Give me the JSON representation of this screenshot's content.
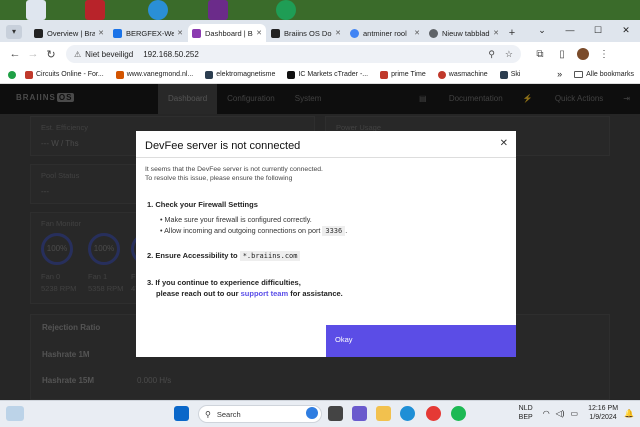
{
  "browser": {
    "tab_list_icon": "▾",
    "tabs": [
      {
        "title": "Overview | Bra",
        "color": "#222222"
      },
      {
        "title": "BERGFEX-Weer",
        "color": "#1a73e8"
      },
      {
        "title": "Dashboard | Bra",
        "color": "#8b3ab0",
        "active": true
      },
      {
        "title": "Braiins OS Do",
        "color": "#222222"
      },
      {
        "title": "antminer rool",
        "color": "#4285f4"
      },
      {
        "title": "Nieuw tabblad",
        "color": "#5f6368"
      }
    ],
    "new_tab": "+",
    "window_controls": [
      "⌄",
      "—",
      "☐",
      "✕"
    ],
    "security_label": "Niet beveiligd",
    "url": "192.168.50.252",
    "bookmarks": [
      {
        "label": "Circuits Online - For...",
        "color": "#c0392b"
      },
      {
        "label": "www.vanegmond.nl...",
        "color": "#d35400"
      },
      {
        "label": "elektromagnetisme",
        "color": "#2c3e50"
      },
      {
        "label": "IC Markets cTrader -...",
        "color": "#111111"
      },
      {
        "label": "prime Time",
        "color": "#c0392b"
      },
      {
        "label": "wasmachine",
        "color": "#c0392b"
      },
      {
        "label": "Ski",
        "color": "#2c3e50"
      }
    ],
    "all_bookmarks": "Alle bookmarks"
  },
  "app": {
    "logo_text": "BRAIINS",
    "logo_os": "OS",
    "nav": [
      "Dashboard",
      "Configuration",
      "System"
    ],
    "nav_right": [
      "Documentation",
      "Quick Actions"
    ],
    "est_efficiency_label": "Est. Efficiency",
    "est_efficiency_value": "--- W / Ths",
    "power_usage_label": "Power Usage",
    "pool_status_label": "Pool Status",
    "pool_status_value": "---",
    "fan_monitor_label": "Fan Monitor",
    "fans": [
      {
        "pct": "100%",
        "name": "Fan 0",
        "rpm": "5238 RPM"
      },
      {
        "pct": "100%",
        "name": "Fan 1",
        "rpm": "5358 RPM"
      },
      {
        "pct": "",
        "name": "Fa",
        "rpm": "47"
      }
    ],
    "rejection_ratio_label": "Rejection Ratio",
    "hashrate_1m_label": "Hashrate 1M",
    "hashrate_15m_label": "Hashrate 15M",
    "hashrate_15m_value": "0.000 H/s"
  },
  "modal": {
    "title": "DevFee server is not connected",
    "intro_line1": "It seems that the DevFee server is not currently connected.",
    "intro_line2": "To resolve this issue, please ensure the following",
    "step1_title": "1. Check your Firewall Settings",
    "step1_bullet1": "Make sure your firewall is configured correctly.",
    "step1_bullet2_pre": "Allow incoming and outgoing connections on port",
    "port": "3336",
    "step2_title": "2. Ensure Accessibility to",
    "domain": "*.braiins.com",
    "step3_line1": "3. If you continue to experience difficulties,",
    "step3_line2_pre": "please reach out to our",
    "support_link": "support team",
    "step3_line2_post": "for assistance.",
    "okay_label": "Okay"
  },
  "taskbar": {
    "search_placeholder": "Search",
    "lang_top": "NLD",
    "lang_bottom": "BEP",
    "time": "12:16 PM",
    "date": "1/9/2024"
  }
}
